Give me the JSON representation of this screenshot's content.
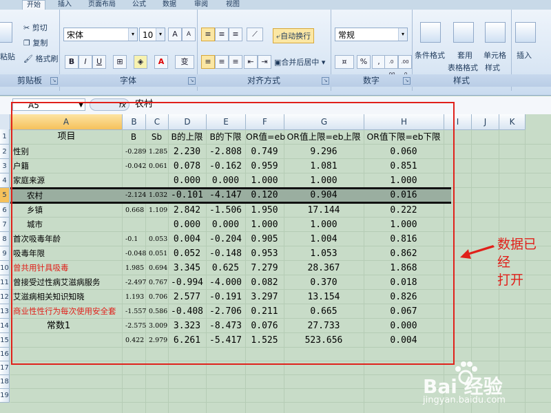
{
  "tabs": [
    "开始",
    "插入",
    "页面布局",
    "公式",
    "数据",
    "审阅",
    "视图"
  ],
  "clipboard": {
    "paste": "粘贴",
    "cut": "剪切",
    "copy": "复制",
    "format_painter": "格式刷",
    "label": "剪贴板"
  },
  "font": {
    "name": "宋体",
    "size": "10",
    "grow": "A",
    "shrink": "A",
    "bold": "B",
    "italic": "I",
    "underline": "U",
    "label": "字体",
    "phonetic": "变"
  },
  "alignment": {
    "wrap": "自动换行",
    "merge": "合并后居中",
    "label": "对齐方式"
  },
  "number": {
    "format": "常规",
    "percent": "%",
    "comma": ",",
    "inc": ".0 .00",
    "dec": ".00 .0",
    "label": "数字"
  },
  "styles": {
    "conditional": "条件格式",
    "table1": "套用",
    "table2": "表格格式",
    "cell1": "单元格",
    "cell2": "样式",
    "label": "样式"
  },
  "cells": {
    "insert": "插入"
  },
  "formula_bar": {
    "name_box": "A5",
    "fx": "fx",
    "content": "农村"
  },
  "columns": [
    "A",
    "B",
    "C",
    "D",
    "E",
    "F",
    "G",
    "H",
    "I",
    "J",
    "K"
  ],
  "rows": [
    "1",
    "2",
    "3",
    "4",
    "5",
    "6",
    "7",
    "8",
    "9",
    "10",
    "11",
    "12",
    "13",
    "14",
    "15",
    "16",
    "17",
    "18",
    "19"
  ],
  "table": [
    [
      "项目",
      "B",
      "Sb",
      "B的上限",
      "B的下限",
      "OR值=eb",
      "OR值上限=eb上限",
      "OR值下限=eb下限"
    ],
    [
      "性别",
      "-0.289",
      "1.285",
      "2.230",
      "-2.808",
      "0.749",
      "9.296",
      "0.060"
    ],
    [
      "户籍",
      "-0.042",
      "0.061",
      "0.078",
      "-0.162",
      "0.959",
      "1.081",
      "0.851"
    ],
    [
      "家庭来源",
      "",
      "",
      "0.000",
      "0.000",
      "1.000",
      "1.000",
      "1.000"
    ],
    [
      "农村",
      "-2.124",
      "1.032",
      "-0.101",
      "-4.147",
      "0.120",
      "0.904",
      "0.016"
    ],
    [
      "乡镇",
      "0.668",
      "1.109",
      "2.842",
      "-1.506",
      "1.950",
      "17.144",
      "0.222"
    ],
    [
      "城市",
      "",
      "",
      "0.000",
      "0.000",
      "1.000",
      "1.000",
      "1.000"
    ],
    [
      "首次吸毒年龄",
      "-0.1",
      "0.053",
      "0.004",
      "-0.204",
      "0.905",
      "1.004",
      "0.816"
    ],
    [
      "吸毒年限",
      "-0.048",
      "0.051",
      "0.052",
      "-0.148",
      "0.953",
      "1.053",
      "0.862"
    ],
    [
      "曾共用针具吸毒",
      "1.985",
      "0.694",
      "3.345",
      "0.625",
      "7.279",
      "28.367",
      "1.868"
    ],
    [
      "曾接受过性病艾滋病服务",
      "-2.497",
      "0.767",
      "-0.994",
      "-4.000",
      "0.082",
      "0.370",
      "0.018"
    ],
    [
      "艾滋病相关知识知晓",
      "1.193",
      "0.706",
      "2.577",
      "-0.191",
      "3.297",
      "13.154",
      "0.826"
    ],
    [
      "商业性性行为每次使用安全套",
      "-1.557",
      "0.586",
      "-0.408",
      "-2.706",
      "0.211",
      "0.665",
      "0.067"
    ],
    [
      "常数1",
      "-2.575",
      "3.009",
      "3.323",
      "-8.473",
      "0.076",
      "27.733",
      "0.000"
    ],
    [
      "",
      "0.422",
      "2.979",
      "6.261",
      "-5.417",
      "1.525",
      "523.656",
      "0.004"
    ]
  ],
  "annotation": [
    "数据已经",
    "打开"
  ],
  "watermark": {
    "brand": "Bai 经验",
    "url": "jingyan.baidu.com"
  },
  "colors": {
    "highlight": "#e0201a",
    "frame": "#e0201a"
  }
}
